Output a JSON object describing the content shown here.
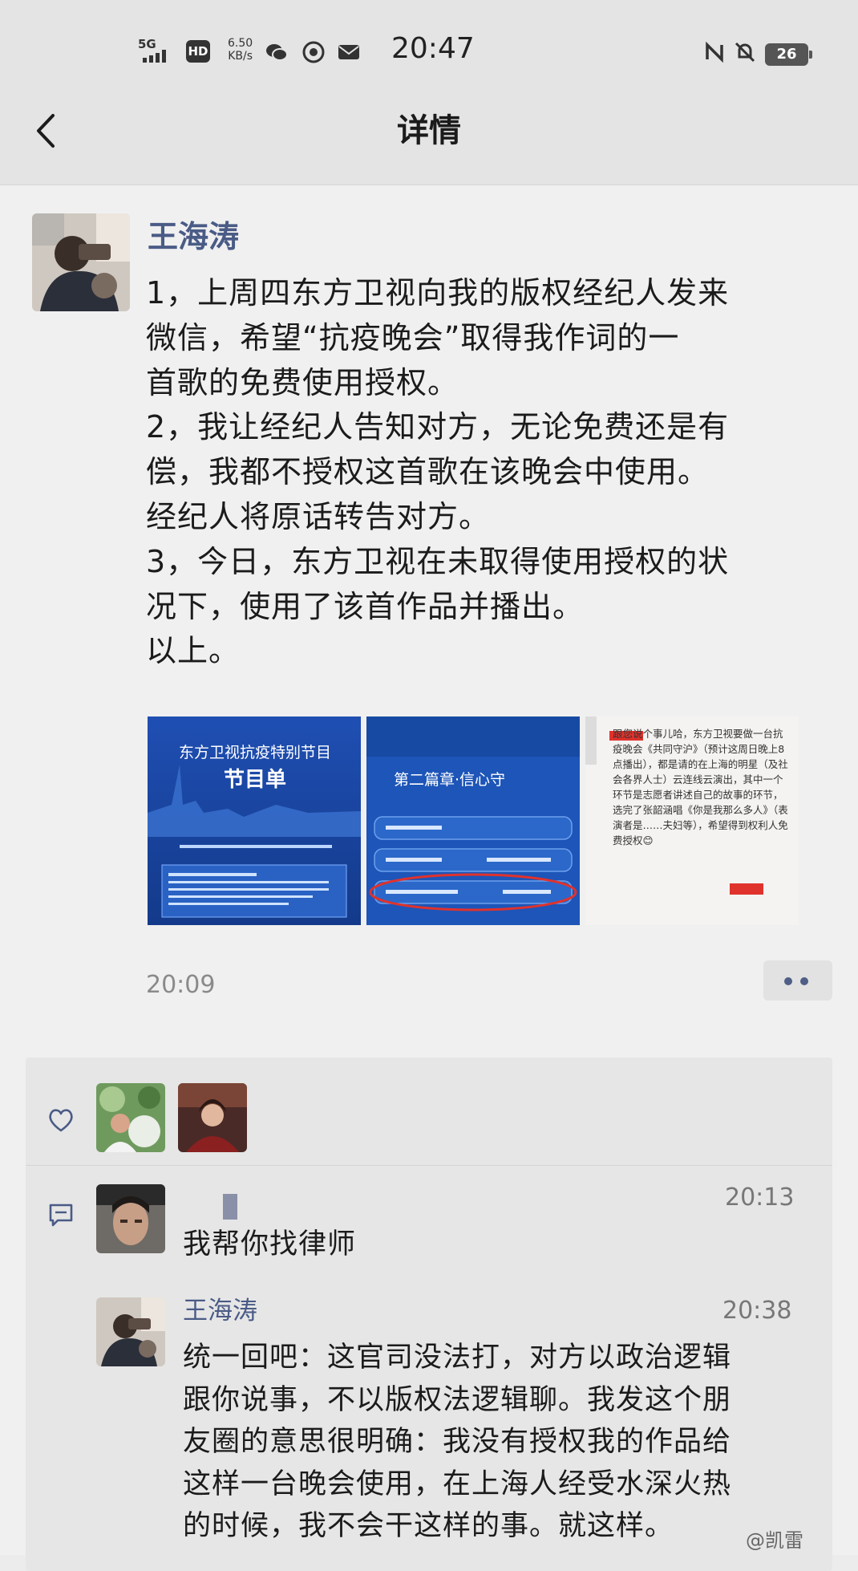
{
  "status_bar": {
    "network": "5G",
    "hd": "HD",
    "speed_value": "6.50",
    "speed_unit": "KB/s",
    "time": "20:47",
    "battery": "26"
  },
  "nav": {
    "title": "详情"
  },
  "post": {
    "author": "王海涛",
    "lines": [
      "1，上周四东方卫视向我的版权经纪人发来",
      "微信，希望“抗疫晚会”取得我作词的一",
      "首歌的免费使用授权。",
      "2，我让经纪人告知对方，无论免费还是有",
      "偿，我都不授权这首歌在该晚会中使用。",
      "经纪人将原话转告对方。",
      "3，今日，东方卫视在未取得使用授权的状",
      "况下，使用了该首作品并播出。",
      "以上。"
    ],
    "photos": {
      "p1": {
        "title": "东方卫视抗疫特别节目",
        "subtitle": "节目单"
      },
      "p2": {
        "title": "第二篇章·信心守"
      },
      "p3": {
        "text": "跟您说个事儿哈，东方卫视要做一台抗疫晚会《共同守沪》（预计这周日晚上8点播出），都是请的在上海的明星（及社会各界人士）云连线云演出，其中一个环节是志愿者讲述自己的故事的环节，选完了张韶涵唱《你是我那么多人》（表演者是……夫妇等），希望得到权利人免费授权😊"
      }
    },
    "time": "20:09"
  },
  "comments": [
    {
      "name": "",
      "time": "20:13",
      "lines": [
        "我帮你找律师"
      ]
    },
    {
      "name": "王海涛",
      "time": "20:38",
      "lines": [
        "统一回吧：这官司没法打，对方以政治逻辑",
        "跟你说事，不以版权法逻辑聊。我发这个朋",
        "友圈的意思很明确：我没有授权我的作品给",
        "这样一台晚会使用，在上海人经受水深火热",
        "的时候，我不会干这样的事。就这样。"
      ]
    }
  ],
  "watermark": "@凯雷",
  "colors": {
    "name_blue": "#4a5b86",
    "background": "#f0f0f0",
    "interact_bg": "#e6e6e6"
  },
  "icons": [
    "back-arrow-icon",
    "heart-icon",
    "comment-icon",
    "more-dots-icon"
  ]
}
